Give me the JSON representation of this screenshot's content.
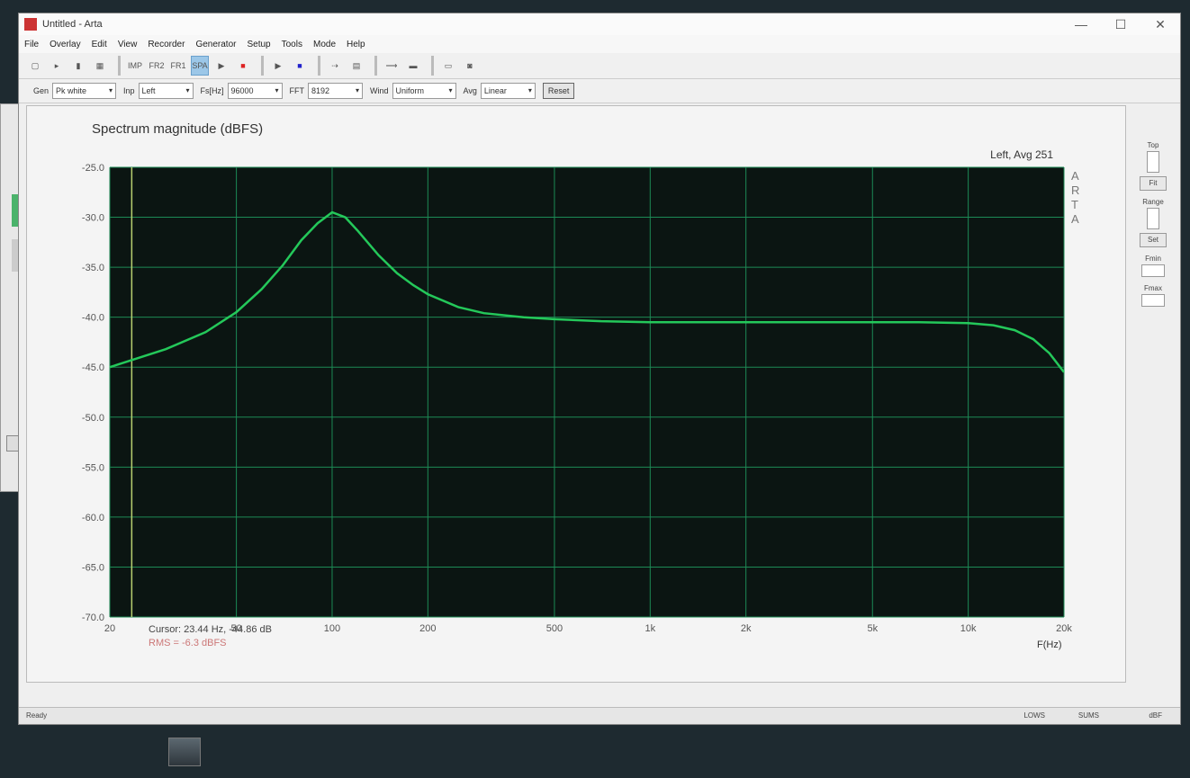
{
  "window": {
    "title": "Untitled - Arta",
    "controls": [
      "—",
      "☐",
      "✕"
    ]
  },
  "menu": [
    "File",
    "Overlay",
    "Edit",
    "View",
    "Recorder",
    "Generator",
    "Setup",
    "Tools",
    "Mode",
    "Help"
  ],
  "toolbar": {
    "buttons": [
      "IMP",
      "FR2",
      "FR1",
      "SPA"
    ],
    "active": "SPA"
  },
  "controls_bar": {
    "gen_label": "Gen",
    "gen_value": "Pk white",
    "inp_label": "Inp",
    "inp_value": "Left",
    "fs_label": "Fs[Hz]",
    "fs_value": "96000",
    "fft_label": "FFT",
    "fft_value": "8192",
    "wind_label": "Wind",
    "wind_value": "Uniform",
    "avg_label": "Avg",
    "avg_value": "Linear",
    "reset_label": "Reset"
  },
  "right_panel": {
    "top_label": "Top",
    "fit_label": "Fit",
    "range_label": "Range",
    "set_label": "Set",
    "fmin_label": "Fmin",
    "fmax_label": "Fmax"
  },
  "cursor_readout": "Cursor: 23.44 Hz, -44.86 dB",
  "rms_readout": "RMS = -6.3 dBFS",
  "status": {
    "left": "Ready",
    "right": [
      "LOWS",
      "SUMS",
      "dBF"
    ]
  },
  "arta_watermark": [
    "A",
    "R",
    "T",
    "A"
  ],
  "colors": {
    "plot_bg": "#0b1512",
    "grid": "#1d8a55",
    "trace": "#24c85a",
    "cursor": "#b8d070"
  },
  "chart_data": {
    "type": "line",
    "title": "Spectrum magnitude (dBFS)",
    "corner_label": "Left, Avg 251",
    "xlabel": "F(Hz)",
    "ylabel": "",
    "xscale": "log",
    "xlim": [
      20,
      20000
    ],
    "ylim": [
      -70,
      -25
    ],
    "grid": true,
    "x_ticks": [
      20,
      50,
      100,
      200,
      500,
      1000,
      2000,
      5000,
      10000,
      20000
    ],
    "x_tick_labels": [
      "20",
      "50",
      "100",
      "200",
      "500",
      "1k",
      "2k",
      "5k",
      "10k",
      "20k"
    ],
    "y_ticks": [
      -25,
      -30,
      -35,
      -40,
      -45,
      -50,
      -55,
      -60,
      -65,
      -70
    ],
    "y_tick_labels": [
      "-25.0",
      "-30.0",
      "-35.0",
      "-40.0",
      "-45.0",
      "-50.0",
      "-55.0",
      "-60.0",
      "-65.0",
      "-70.0"
    ],
    "cursor_x": 23.44,
    "series": [
      {
        "x": [
          20,
          30,
          40,
          50,
          60,
          70,
          80,
          90,
          100,
          110,
          120,
          140,
          160,
          180,
          200,
          250,
          300,
          400,
          500,
          700,
          1000,
          2000,
          3000,
          5000,
          7000,
          10000,
          12000,
          14000,
          16000,
          18000,
          20000
        ],
        "y": [
          -45.0,
          -43.2,
          -41.5,
          -39.5,
          -37.2,
          -34.8,
          -32.3,
          -30.6,
          -29.5,
          -30.0,
          -31.3,
          -33.8,
          -35.6,
          -36.8,
          -37.7,
          -39.0,
          -39.6,
          -40.0,
          -40.2,
          -40.4,
          -40.5,
          -40.5,
          -40.5,
          -40.5,
          -40.5,
          -40.6,
          -40.8,
          -41.3,
          -42.2,
          -43.6,
          -45.5
        ]
      }
    ]
  }
}
